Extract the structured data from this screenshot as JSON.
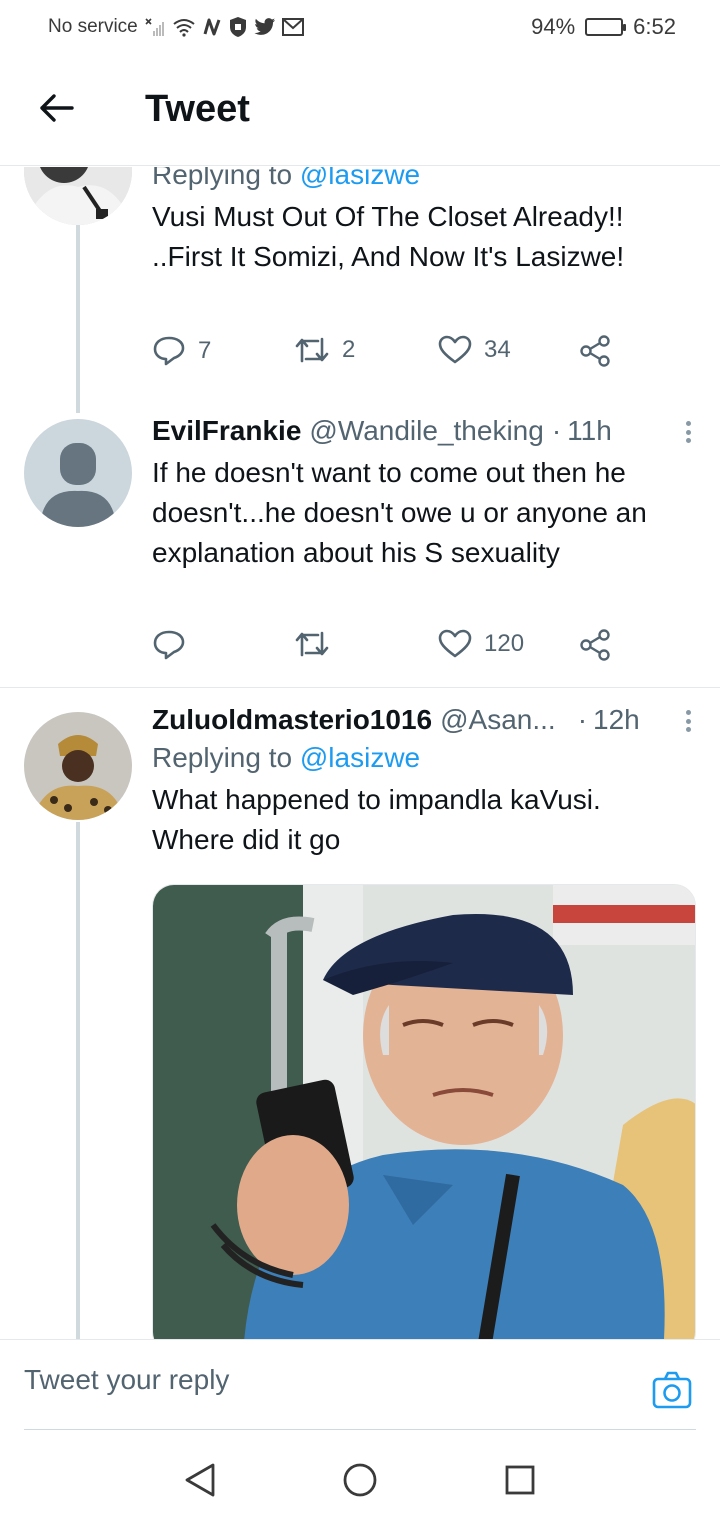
{
  "status_bar": {
    "carrier": "No service",
    "battery": "94%",
    "battery_level": 0.94,
    "time": "6:52"
  },
  "header": {
    "title": "Tweet",
    "back_icon": "arrow-left-icon"
  },
  "tweets": [
    {
      "reply_prefix": "Replying to",
      "reply_mention": "@lasizwe",
      "text": "Vusi Must Out Of The Closet Already!! ..First It Somizi, And Now It's Lasizwe!",
      "replies": "7",
      "retweets": "2",
      "likes": "34"
    },
    {
      "name": "EvilFrankie",
      "handle": "@Wandile_theking",
      "dot": "·",
      "time": "11h",
      "text": "If he doesn't want to come out then he doesn't...he doesn't owe u or anyone an explanation about his S sexuality",
      "replies": "",
      "retweets": "",
      "likes": "120"
    },
    {
      "name": "Zuluoldmasterio1016",
      "handle": "@Asan...",
      "dot": "·",
      "time": "12h",
      "reply_prefix": "Replying to",
      "reply_mention": "@lasizwe",
      "text": "What happened to impandla kaVusi. Where did it go"
    }
  ],
  "reply_bar": {
    "placeholder": "Tweet your reply",
    "camera_icon": "camera-icon"
  },
  "colors": {
    "link": "#1d9bf0",
    "secondary_text": "#536471",
    "thread_line": "#cfd9de"
  }
}
